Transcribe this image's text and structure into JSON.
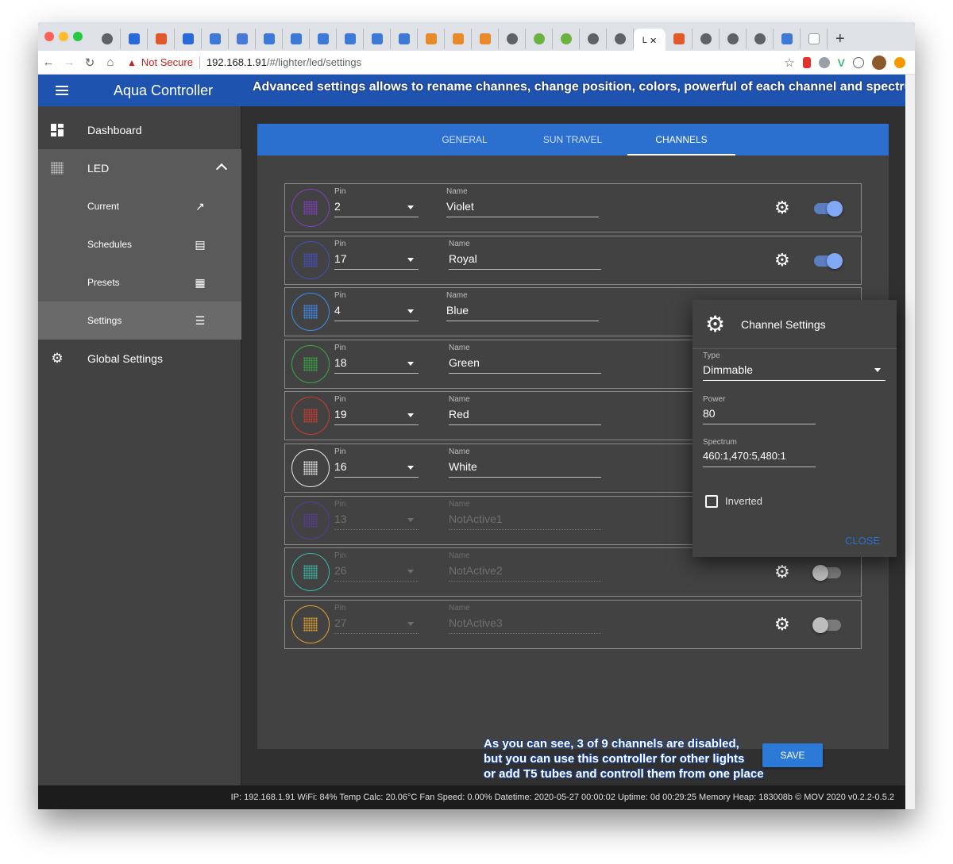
{
  "browser": {
    "address": {
      "security_label": "Not Secure",
      "host": "192.168.1.91",
      "path": "/#/lighter/led/settings"
    },
    "active_tab_title": "L"
  },
  "app": {
    "title": "Aqua Controller",
    "banner": "Advanced settings allows to rename channes, change position, colors, powerful of each channel and spectrum"
  },
  "sidebar": {
    "items": [
      {
        "label": "Dashboard",
        "icon": "dashboard-icon"
      },
      {
        "label": "LED",
        "icon": "led-icon"
      },
      {
        "label": "Current",
        "icon": "trending-up-icon"
      },
      {
        "label": "Schedules",
        "icon": "library-books-icon"
      },
      {
        "label": "Presets",
        "icon": "grid-icon"
      },
      {
        "label": "Settings",
        "icon": "tune-icon"
      },
      {
        "label": "Global Settings",
        "icon": "gear-icon"
      }
    ]
  },
  "tabs": [
    {
      "label": "GENERAL",
      "active": false
    },
    {
      "label": "SUN TRAVEL",
      "active": false
    },
    {
      "label": "CHANNELS",
      "active": true
    }
  ],
  "field_labels": {
    "pin": "Pin",
    "name": "Name"
  },
  "channels": [
    {
      "pin": "2",
      "name": "Violet",
      "color": "#7e3fbf",
      "enabled": true,
      "active": true
    },
    {
      "pin": "17",
      "name": "Royal",
      "color": "#4050c0",
      "enabled": true,
      "active": true
    },
    {
      "pin": "4",
      "name": "Blue",
      "color": "#3d8df5",
      "enabled": true,
      "active": true
    },
    {
      "pin": "18",
      "name": "Green",
      "color": "#3aa845",
      "enabled": true,
      "active": true
    },
    {
      "pin": "19",
      "name": "Red",
      "color": "#d03a32",
      "enabled": true,
      "active": true
    },
    {
      "pin": "16",
      "name": "White",
      "color": "#e8e8e8",
      "enabled": true,
      "active": true
    },
    {
      "pin": "13",
      "name": "NotActive1",
      "color": "#5a3a9a",
      "enabled": false,
      "active": false
    },
    {
      "pin": "26",
      "name": "NotActive2",
      "color": "#3ab8a8",
      "enabled": false,
      "active": false
    },
    {
      "pin": "27",
      "name": "NotActive3",
      "color": "#e0a030",
      "enabled": false,
      "active": false
    }
  ],
  "dialog": {
    "title": "Channel Settings",
    "type_label": "Type",
    "type_value": "Dimmable",
    "power_label": "Power",
    "power_value": "80",
    "spectrum_label": "Spectrum",
    "spectrum_value": "460:1,470:5,480:1",
    "inverted_label": "Inverted",
    "inverted": false,
    "close_label": "CLOSE"
  },
  "note": {
    "lines": [
      "As you can see, 3 of 9 channels are disabled,",
      "but you can use this controller for other lights",
      "or add T5 tubes and controll them from one place"
    ]
  },
  "save_label": "SAVE",
  "footer": "IP: 192.168.1.91 WiFi: 84% Temp Calc: 20.06°C Fan Speed: 0.00% Datetime: 2020-05-27 00:00:02 Uptime: 0d 00:29:25 Memory Heap: 183008b © MOV 2020 v0.2.2-0.5.2",
  "colors": {
    "accent": "#2b6fcf",
    "appbar": "#1e54b0",
    "switch_on": "#82a8f5"
  }
}
